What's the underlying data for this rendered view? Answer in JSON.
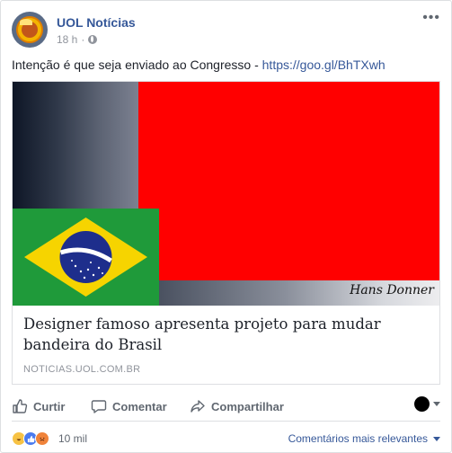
{
  "post": {
    "page_name": "UOL Notícias",
    "time": "18 h",
    "separator": "·",
    "text": "Intenção é que seja enviado ao Congresso - ",
    "link": "https://goo.gl/BhTXwh"
  },
  "preview": {
    "signature": "Hans Donner",
    "title": "Designer famoso apresenta projeto para mudar bandeira do Brasil",
    "domain": "NOTICIAS.UOL.COM.BR"
  },
  "actions": {
    "like": "Curtir",
    "comment": "Comentar",
    "share": "Compartilhar"
  },
  "reactions": {
    "icons": [
      "haha",
      "like",
      "angry"
    ],
    "count": "10 mil",
    "sort_label": "Comentários mais relevantes"
  },
  "colors": {
    "link": "#365899",
    "flag_green": "#1f9a3a",
    "flag_yellow": "#f6d400",
    "flag_blue": "#1e2e8c",
    "red": "#ff0000"
  }
}
